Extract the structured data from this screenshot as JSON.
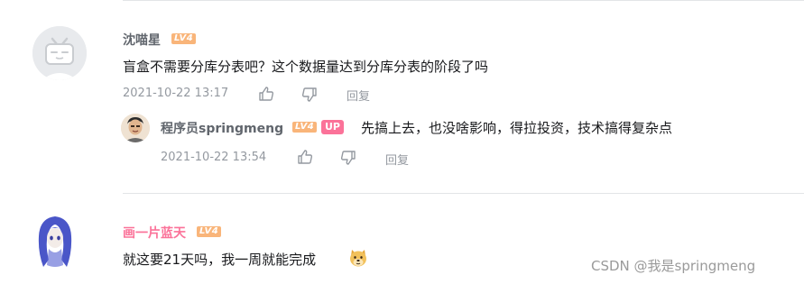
{
  "comments": [
    {
      "user": "沈喵星",
      "level": "LV4",
      "text": "盲盒不需要分库分表吧？这个数据量达到分库分表的阶段了吗",
      "time": "2021-10-22 13:17",
      "reply_label": "回复",
      "reply": {
        "user": "程序员springmeng",
        "level": "LV4",
        "up_badge": "UP",
        "text": "先搞上去，也没啥影响，得拉投资，技术搞得复杂点",
        "time": "2021-10-22 13:54",
        "reply_label": "回复"
      }
    },
    {
      "user": "画一片蓝天",
      "level": "LV4",
      "text": "就这要21天吗，我一周就能完成",
      "emoji": "doge-emoji"
    }
  ],
  "watermark": "CSDN @我是springmeng",
  "colors": {
    "level_badge": "#f9b57a",
    "up_badge": "#fb7299",
    "pink_name": "#fb7299",
    "meta": "#9499a0"
  }
}
